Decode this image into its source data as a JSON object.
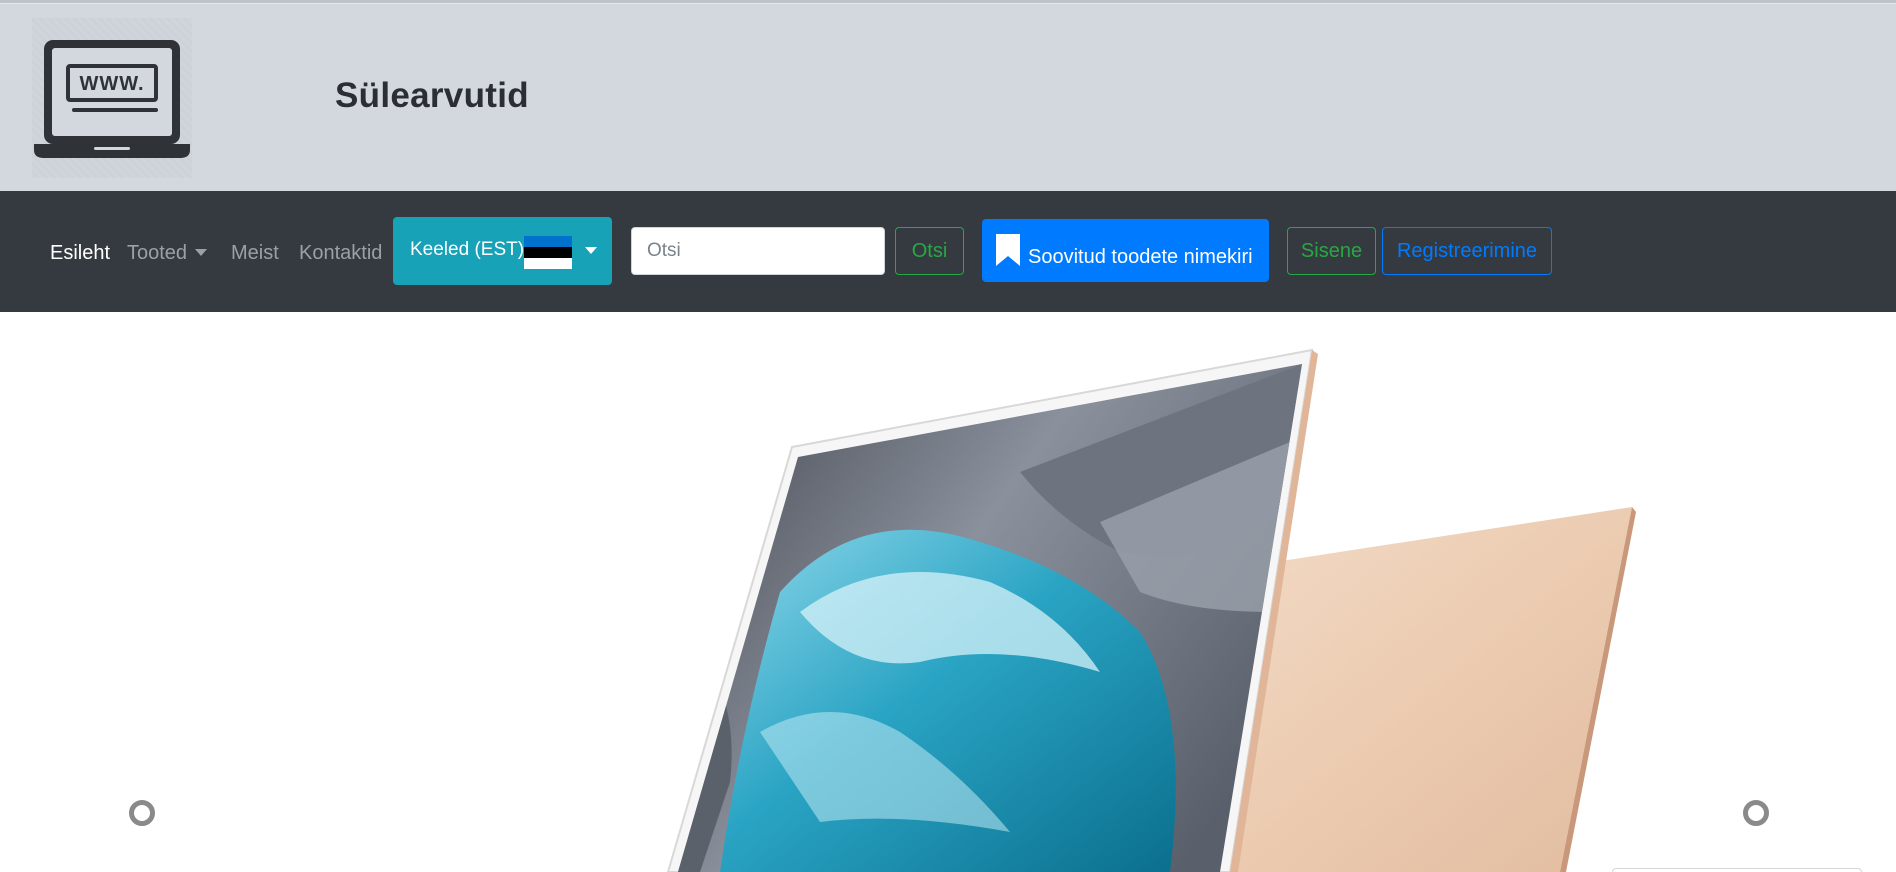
{
  "header": {
    "logo_text": "WWW.",
    "title": "Sülearvutid"
  },
  "nav": {
    "items": [
      {
        "label": "Esileht",
        "active": true
      },
      {
        "label": "Tooted",
        "dropdown": true
      },
      {
        "label": "Meist"
      },
      {
        "label": "Kontaktid"
      }
    ],
    "language_button": {
      "label": "Keeled (EST)",
      "flag": "estonia-flag-icon"
    },
    "search": {
      "placeholder": "Otsi",
      "value": "",
      "button_label": "Otsi"
    },
    "recommended_button": {
      "label": "Soovitud toodete nimekiri",
      "icon": "bookmark-icon"
    },
    "login_label": "Sisene",
    "register_label": "Registreerimine"
  },
  "carousel": {
    "image": "laptop-photo",
    "prev_icon": "circle-prev-icon",
    "next_icon": "circle-next-icon"
  },
  "colors": {
    "header_bg": "#d3d7de",
    "navbar_bg": "#343a40",
    "language_btn": "#17a2b8",
    "primary": "#007bff",
    "success": "#28a745",
    "flag_blue": "#0072ce",
    "flag_black": "#000000",
    "flag_white": "#ffffff"
  }
}
